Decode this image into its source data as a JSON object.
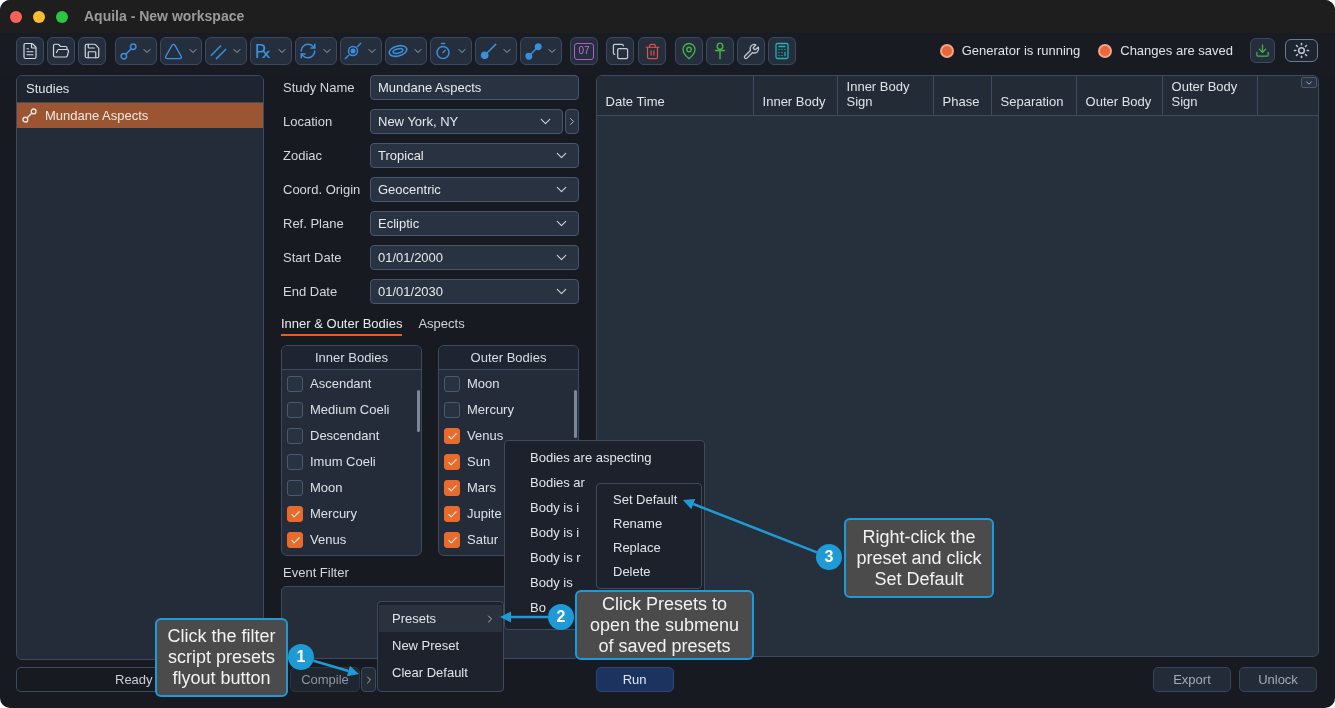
{
  "window": {
    "title": "Aquila - New workspace"
  },
  "toolbar": {
    "retrograde_symbol": "℞",
    "calendar_day": "07",
    "indicators": [
      {
        "label": "Generator is running",
        "on": true
      },
      {
        "label": "Changes are saved",
        "on": true
      }
    ]
  },
  "studies": {
    "title": "Studies",
    "items": [
      {
        "label": "Mundane Aspects",
        "selected": true
      }
    ]
  },
  "study_form": {
    "fields": [
      {
        "label": "Study Name",
        "value": "Mundane Aspects",
        "kind": "text"
      },
      {
        "label": "Location",
        "value": "New York, NY",
        "kind": "location"
      },
      {
        "label": "Zodiac",
        "value": "Tropical",
        "kind": "dropdown"
      },
      {
        "label": "Coord. Origin",
        "value": "Geocentric",
        "kind": "dropdown"
      },
      {
        "label": "Ref. Plane",
        "value": "Ecliptic",
        "kind": "dropdown"
      },
      {
        "label": "Start Date",
        "value": "01/01/2000",
        "kind": "dropdown"
      },
      {
        "label": "End Date",
        "value": "01/01/2030",
        "kind": "dropdown"
      }
    ]
  },
  "body_tabs": [
    {
      "label": "Inner & Outer Bodies",
      "selected": true
    },
    {
      "label": "Aspects",
      "selected": false
    }
  ],
  "inner_bodies": {
    "title": "Inner Bodies",
    "items": [
      {
        "label": "Ascendant",
        "checked": false
      },
      {
        "label": "Medium Coeli",
        "checked": false
      },
      {
        "label": "Descendant",
        "checked": false
      },
      {
        "label": "Imum Coeli",
        "checked": false
      },
      {
        "label": "Moon",
        "checked": false
      },
      {
        "label": "Mercury",
        "checked": true
      },
      {
        "label": "Venus",
        "checked": true
      }
    ]
  },
  "outer_bodies": {
    "title": "Outer Bodies",
    "items": [
      {
        "label": "Moon",
        "checked": false
      },
      {
        "label": "Mercury",
        "checked": false
      },
      {
        "label": "Venus",
        "checked": true
      },
      {
        "label": "Sun",
        "checked": true
      },
      {
        "label": "Mars",
        "checked": true
      },
      {
        "label": "Jupite",
        "checked": true
      },
      {
        "label": "Satur",
        "checked": true
      }
    ]
  },
  "event_filter": {
    "label": "Event Filter"
  },
  "status_bar": {
    "status": "Ready",
    "compile": "Compile"
  },
  "results_table": {
    "columns": [
      "Date Time",
      "Inner Body",
      "Inner Body Sign",
      "Phase",
      "Separation",
      "Outer Body",
      "Outer Body Sign"
    ]
  },
  "actions": {
    "run": "Run",
    "export": "Export",
    "unlock": "Unlock"
  },
  "filter_flyout_menu": {
    "items": [
      {
        "label": "Presets",
        "selected": true,
        "kind": "submenu"
      },
      {
        "label": "New Preset",
        "selected": false,
        "kind": "item"
      },
      {
        "label": "Clear Default",
        "selected": false,
        "kind": "item"
      }
    ]
  },
  "saved_presets_menu": {
    "items": [
      "Bodies are aspecting",
      "Bodies ar",
      "Body is i",
      "Body is i",
      "Body is r",
      "Body is",
      "Bo"
    ]
  },
  "preset_context_menu": {
    "items": [
      "Set Default",
      "Rename",
      "Replace",
      "Delete"
    ]
  },
  "callouts": [
    {
      "number": "1",
      "text": "Click the filter script presets flyout button"
    },
    {
      "number": "2",
      "text": "Click Presets to open the submenu of saved presets"
    },
    {
      "number": "3",
      "text": "Right-click the preset and click Set Default"
    }
  ]
}
